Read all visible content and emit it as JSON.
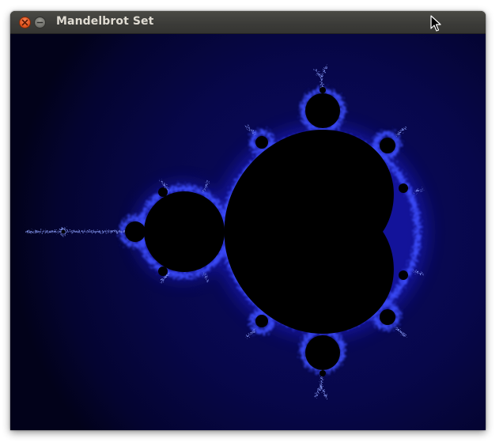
{
  "window": {
    "title": "Mandelbrot Set",
    "close_icon": "close-icon",
    "minimize_icon": "minimize-icon"
  },
  "render": {
    "fractal": "mandelbrot",
    "background_color": "#00001a",
    "outer_glow_color": "#060640",
    "edge_color": "#4a5cff",
    "filament_color": "#9fb2ff",
    "interior_color": "#000000"
  }
}
